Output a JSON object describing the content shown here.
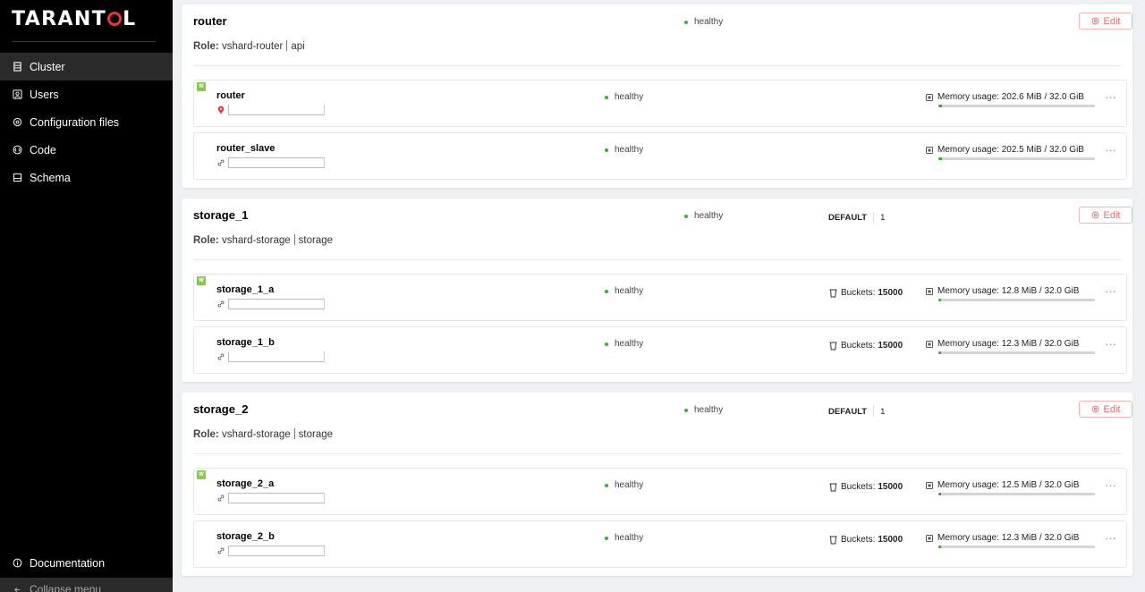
{
  "sidebar": {
    "logo_text": "TARANT",
    "logo_suffix": "L",
    "items": [
      {
        "label": "Cluster",
        "icon": "cluster-icon"
      },
      {
        "label": "Users",
        "icon": "users-icon"
      },
      {
        "label": "Configuration files",
        "icon": "config-files-icon"
      },
      {
        "label": "Code",
        "icon": "code-icon"
      },
      {
        "label": "Schema",
        "icon": "schema-icon"
      }
    ],
    "documentation": "Documentation",
    "collapse": "Collapse menu"
  },
  "colors": {
    "accent_red": "#e83737",
    "healthy": "#34b233",
    "leader": "#88c94b"
  },
  "replicasets": [
    {
      "name": "router",
      "status": "healthy",
      "role_label": "Role:",
      "roles": [
        "vshard-router",
        "api"
      ],
      "edit_label": "Edit",
      "servers": [
        {
          "name": "router",
          "status": "healthy",
          "memory": "Memory usage: 202.6 MiB / 32.0 GiB",
          "memory_fraction": 0.02
        },
        {
          "name": "router_slave",
          "status": "healthy",
          "memory": "Memory usage: 202.5 MiB / 32.0 GiB",
          "memory_fraction": 0.02
        }
      ]
    },
    {
      "name": "storage_1",
      "status": "healthy",
      "weight_label": "DEFAULT",
      "weight_value": "1",
      "role_label": "Role:",
      "roles": [
        "vshard-storage",
        "storage"
      ],
      "edit_label": "Edit",
      "servers": [
        {
          "name": "storage_1_a",
          "status": "healthy",
          "buckets_label": "Buckets:",
          "buckets": "15000",
          "memory": "Memory usage: 12.8 MiB / 32.0 GiB",
          "memory_fraction": 0.015
        },
        {
          "name": "storage_1_b",
          "status": "healthy",
          "buckets_label": "Buckets:",
          "buckets": "15000",
          "memory": "Memory usage: 12.3 MiB / 32.0 GiB",
          "memory_fraction": 0.015
        }
      ]
    },
    {
      "name": "storage_2",
      "status": "healthy",
      "weight_label": "DEFAULT",
      "weight_value": "1",
      "role_label": "Role:",
      "roles": [
        "vshard-storage",
        "storage"
      ],
      "edit_label": "Edit",
      "servers": [
        {
          "name": "storage_2_a",
          "status": "healthy",
          "buckets_label": "Buckets:",
          "buckets": "15000",
          "memory": "Memory usage: 12.5 MiB / 32.0 GiB",
          "memory_fraction": 0.015
        },
        {
          "name": "storage_2_b",
          "status": "healthy",
          "buckets_label": "Buckets:",
          "buckets": "15000",
          "memory": "Memory usage: 12.3 MiB / 32.0 GiB",
          "memory_fraction": 0.015
        }
      ]
    }
  ]
}
